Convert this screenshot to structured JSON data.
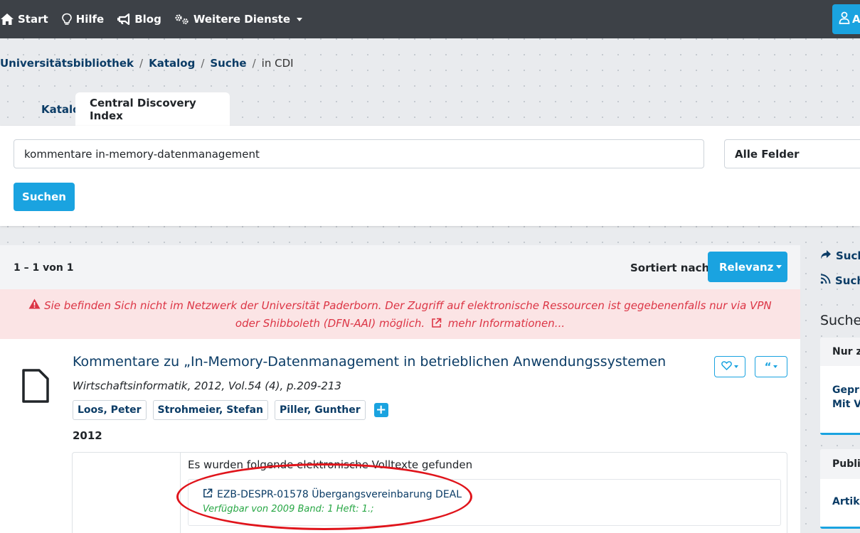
{
  "nav": {
    "start": "Start",
    "hilfe": "Hilfe",
    "blog": "Blog",
    "weitere": "Weitere Dienste",
    "account": "A"
  },
  "breadcrumb": {
    "items": [
      "Universitätsbibliothek",
      "Katalog",
      "Suche"
    ],
    "current": "in CDI"
  },
  "tabs": [
    "Katalog",
    "Central Discovery Index"
  ],
  "search": {
    "query": "kommentare in-memory-datenmanagement",
    "field": "Alle Felder",
    "button": "Suchen"
  },
  "results": {
    "count": "1 – 1 von 1",
    "sort_label": "Sortiert nach",
    "sort_value": "Relevanz"
  },
  "alert": {
    "text": "Sie befinden Sich nicht im Netzwerk der Universität Paderborn. Der Zugriff auf elektronische Ressourcen ist gegebenenfalls nur via VPN oder Shibboleth (DFN-AAI) möglich.",
    "link": "mehr Informationen..."
  },
  "result": {
    "title": "Kommentare zu „In-Memory-Datenmanagement in betrieblichen Anwendungssystemen",
    "source": "Wirtschaftsinformatik, 2012, Vol.54 (4), p.209-213",
    "authors": [
      "Loos, Peter",
      "Strohmeier, Stefan",
      "Piller, Gunther"
    ],
    "year": "2012",
    "fulltext_heading": "Es wurden folgende elektronische Volltexte gefunden",
    "fulltext_link": "EZB-DESPR-01578 Übergangsvereinbarung DEAL",
    "fulltext_availability": "Verfügbar von 2009 Band: 1 Heft: 1.;"
  },
  "sidebar": {
    "link1": "Such",
    "link2": "Such",
    "heading": "Suche",
    "facet1": {
      "head": "Nur z",
      "items": [
        "Gepru",
        "Mit V"
      ]
    },
    "facet2": {
      "head": "Publi",
      "items": [
        "Artik"
      ]
    }
  },
  "colors": {
    "navbar": "#3d4147",
    "accent": "#1aa3e0",
    "link": "#0b3c66",
    "alert_bg": "#fbe4e5",
    "alert_text": "#dc3545",
    "availability": "#28a745",
    "annotation": "#e0141b"
  },
  "icons": [
    "home-icon",
    "lightbulb-icon",
    "megaphone-icon",
    "cogs-icon",
    "user-icon",
    "warning-icon",
    "external-link-icon",
    "document-icon",
    "heart-icon",
    "quote-icon",
    "share-icon",
    "rss-icon"
  ]
}
